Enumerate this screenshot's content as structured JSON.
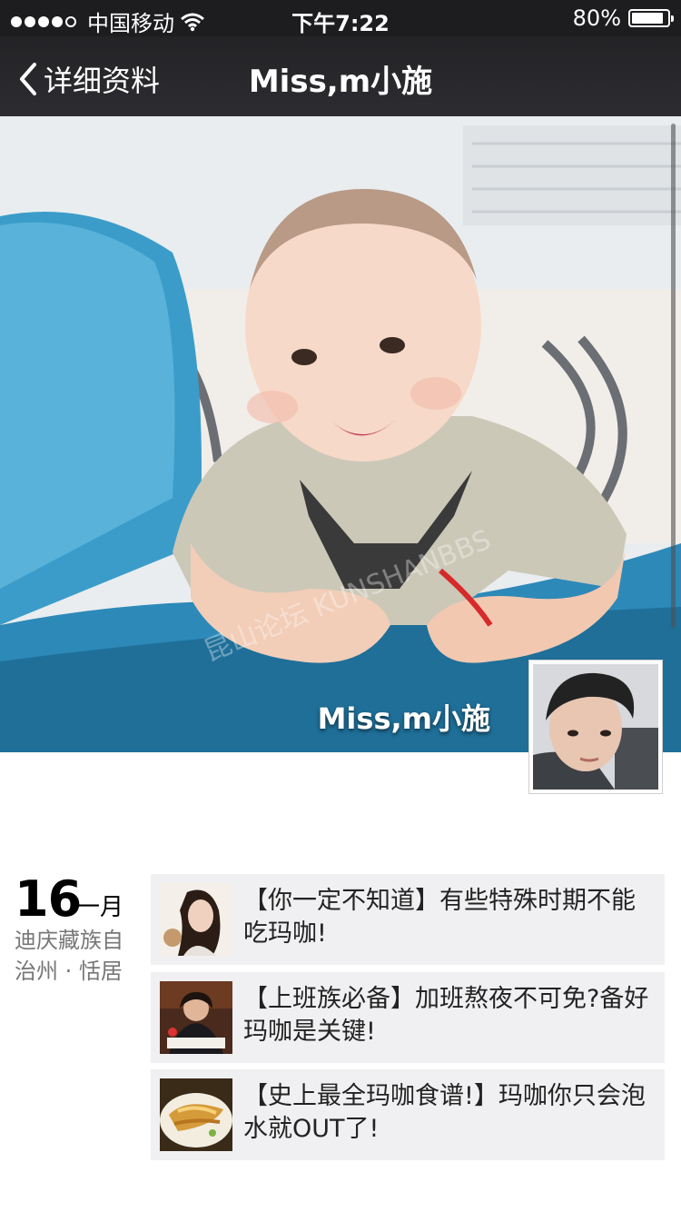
{
  "status_bar": {
    "carrier": "中国移动",
    "time": "下午7:22",
    "battery": "80%",
    "battery_level": 0.8
  },
  "nav": {
    "back_label": "详细资料",
    "title": "Miss,m小施"
  },
  "profile": {
    "cover_name": "Miss,m小施",
    "cover_watermark": "昆山论坛 KUNSHANBBS"
  },
  "timeline": {
    "day": "16",
    "month": "一月",
    "location": "迪庆藏族自治州 · 恬居",
    "posts": [
      {
        "title": "【你一定不知道】有些特殊时期不能吃玛咖!",
        "thumb": "woman-portrait"
      },
      {
        "title": "【上班族必备】加班熬夜不可免?备好玛咖是关键!",
        "thumb": "tired-worker"
      },
      {
        "title": "【史上最全玛咖食谱!】玛咖你只会泡水就OUT了!",
        "thumb": "food-dish"
      }
    ]
  }
}
